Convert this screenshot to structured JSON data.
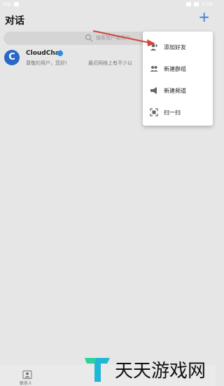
{
  "statusbar": {
    "left_text": "Yep",
    "time": "2:56"
  },
  "header": {
    "title": "对话",
    "add_icon": "plus-icon"
  },
  "search": {
    "placeholder": "搜索用户或用户"
  },
  "chats": [
    {
      "name": "CloudChat",
      "preview": "尊敬的用户，您好!",
      "preview2": "最近网络上有不少以"
    }
  ],
  "menu": {
    "items": [
      {
        "label": "添加好友",
        "icon": "add-friend-icon"
      },
      {
        "label": "新建群组",
        "icon": "group-icon"
      },
      {
        "label": "新建频道",
        "icon": "megaphone-icon"
      },
      {
        "label": "扫一扫",
        "icon": "scan-icon"
      }
    ]
  },
  "bottom_nav": {
    "contacts_label": "联系人"
  },
  "watermark": {
    "text": "天天游戏网"
  },
  "colors": {
    "accent": "#2f7fd8",
    "arrow": "#d6453a",
    "avatar": "#2a67c9"
  }
}
